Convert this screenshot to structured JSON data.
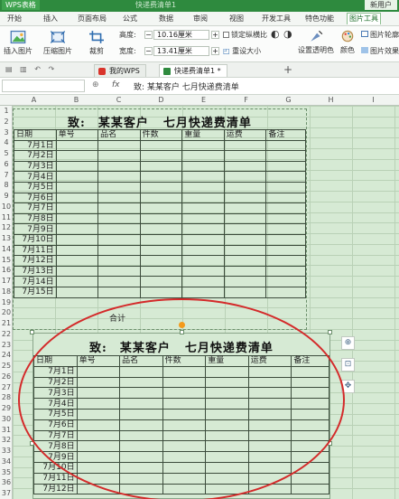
{
  "titlebar": {
    "app_name": "WPS表格",
    "document_name": "快递费清单1",
    "user_button": "新用户"
  },
  "menu_tabs": [
    {
      "label": "开始"
    },
    {
      "label": "插入"
    },
    {
      "label": "页面布局"
    },
    {
      "label": "公式"
    },
    {
      "label": "数据"
    },
    {
      "label": "审阅"
    },
    {
      "label": "视图"
    },
    {
      "label": "开发工具"
    },
    {
      "label": "特色功能"
    },
    {
      "label": "图片工具",
      "active": true
    }
  ],
  "ribbon": {
    "insert_picture": "插入图片",
    "compress_picture": "压缩图片",
    "crop": "裁剪",
    "height_label": "高度:",
    "height_value": "10.16厘米",
    "width_label": "宽度:",
    "width_value": "13.41厘米",
    "lock_aspect": "锁定纵横比",
    "reset_size": "重设大小",
    "set_transparent": "设置透明色",
    "color": "颜色",
    "picture_outline": "图片轮廓",
    "picture_effect": "图片效果"
  },
  "doc_tabs": [
    {
      "label": "我的WPS",
      "active": false
    },
    {
      "label": "快递费清单1 *",
      "active": true
    }
  ],
  "formula_bar": {
    "fx": "fx",
    "content": "致:   某某客户   七月快递费清单"
  },
  "columns": [
    "A",
    "B",
    "C",
    "D",
    "E",
    "F",
    "G",
    "H",
    "I"
  ],
  "rows": [
    "1",
    "2",
    "3",
    "4",
    "5",
    "6",
    "7",
    "8",
    "9",
    "10",
    "11",
    "12",
    "13",
    "14",
    "15",
    "16",
    "17",
    "18",
    "19",
    "20",
    "21",
    "22",
    "23",
    "24",
    "25",
    "26",
    "27",
    "28",
    "29",
    "30",
    "31",
    "32",
    "33",
    "34",
    "35",
    "36",
    "37"
  ],
  "sheet": {
    "to_label": "致:",
    "recipient": "某某客户",
    "doc_title": "七月快递费清单",
    "headers": [
      "日期",
      "单号",
      "品名",
      "件数",
      "重量",
      "运费",
      "备注"
    ],
    "dates": [
      "7月1日",
      "7月2日",
      "7月3日",
      "7月4日",
      "7月5日",
      "7月6日",
      "7月7日",
      "7月8日",
      "7月9日",
      "7月10日",
      "7月11日",
      "7月12日",
      "7月13日",
      "7月14日",
      "7月15日"
    ],
    "total_label": "合计"
  },
  "image_object": {
    "to_label": "致:",
    "recipient": "某某客户",
    "doc_title": "七月快递费清单",
    "headers": [
      "日期",
      "单号",
      "品名",
      "件数",
      "重量",
      "运费",
      "备注"
    ],
    "dates": [
      "7月1日",
      "7月2日",
      "7月3日",
      "7月4日",
      "7月5日",
      "7月6日",
      "7月7日",
      "7月8日",
      "7月9日",
      "7月10日",
      "7月11日",
      "7月12日"
    ]
  },
  "colors": {
    "sheet_bg": "#d6ead4",
    "accent_green": "#2e8a3e",
    "annotation_red": "#d42a2a",
    "rotate_handle": "#f49a1b"
  }
}
